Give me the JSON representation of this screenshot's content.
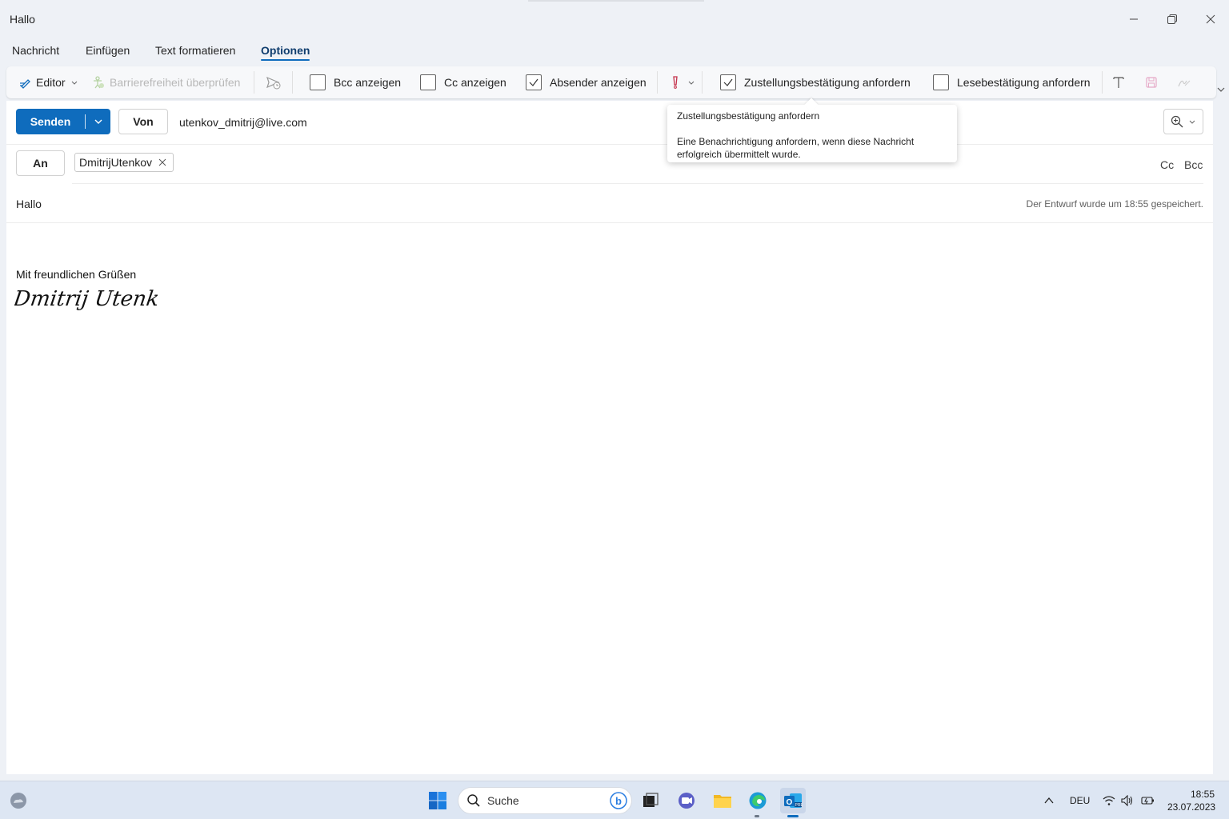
{
  "window": {
    "title": "Hallo"
  },
  "tabs": [
    "Nachricht",
    "Einfügen",
    "Text formatieren",
    "Optionen"
  ],
  "ribbon": {
    "editor": "Editor",
    "accessibility": "Barrierefreiheit überprüfen",
    "bcc": "Bcc anzeigen",
    "cc": "Cc anzeigen",
    "sender": "Absender anzeigen",
    "delivery": "Zustellungsbestätigung anfordern",
    "read": "Lesebestätigung anfordern"
  },
  "compose": {
    "send": "Senden",
    "from_label": "Von",
    "from_address": "utenkov_dmitrij@live.com",
    "to_label": "An",
    "recipient": "DmitrijUtenkov",
    "cc_link": "Cc",
    "bcc_link": "Bcc",
    "subject": "Hallo",
    "saved_status": "Der Entwurf wurde um 18:55 gespeichert.",
    "greeting": "Mit freundlichen Grüßen",
    "signature": "Dmitrij Utenkov"
  },
  "tooltip": {
    "title": "Zustellungsbestätigung anfordern",
    "body": "Eine Benachrichtigung anfordern, wenn diese Nachricht erfolgreich übermittelt wurde."
  },
  "taskbar": {
    "search": "Suche",
    "language": "DEU",
    "time": "18:55",
    "date": "23.07.2023"
  },
  "colors": {
    "accent": "#0f6cbd",
    "window_bg": "#eef1f6",
    "taskbar_bg": "#dde6f3"
  }
}
